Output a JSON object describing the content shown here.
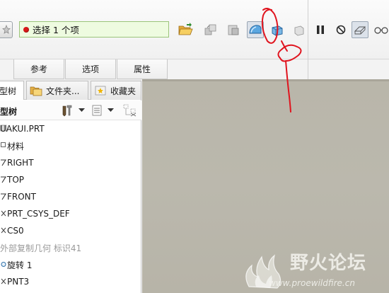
{
  "toolbar": {
    "selection_text": "选择 1 个项",
    "status_color": "#d81818"
  },
  "dashboard_tabs": [
    {
      "label": "参考"
    },
    {
      "label": "选项"
    },
    {
      "label": "属性"
    }
  ],
  "navigator_tabs": [
    {
      "label": "型树",
      "icon": "model-tree-icon"
    },
    {
      "label": "文件夹...",
      "icon": "folder-browser-icon"
    },
    {
      "label": "收藏夹",
      "icon": "favorites-icon"
    }
  ],
  "tree": {
    "header": "型树",
    "items": [
      {
        "lead": "",
        "label": "UAKUI.PRT",
        "icon": "part-icon",
        "disabled": false
      },
      {
        "lead": "□",
        "label": "材料",
        "icon": "material-icon",
        "disabled": false
      },
      {
        "lead": "7",
        "label": "RIGHT",
        "icon": "datum-plane-icon",
        "disabled": false
      },
      {
        "lead": "7",
        "label": "TOP",
        "icon": "datum-plane-icon",
        "disabled": false
      },
      {
        "lead": "7",
        "label": "FRONT",
        "icon": "datum-plane-icon",
        "disabled": false
      },
      {
        "lead": "×",
        "label": "PRT_CSYS_DEF",
        "icon": "csys-icon",
        "disabled": false
      },
      {
        "lead": "×",
        "label": "CS0",
        "icon": "csys-icon",
        "disabled": false
      },
      {
        "lead": "",
        "label": "外部复制几何 标识41",
        "icon": "external-copy-geometry-icon",
        "disabled": true
      },
      {
        "lead": "◇",
        "label": "旋转 1",
        "icon": "revolve-icon",
        "disabled": false
      },
      {
        "lead": "×",
        "label": "PNT3",
        "icon": "datum-point-icon",
        "disabled": false
      }
    ]
  },
  "watermark": {
    "title": "野火论坛",
    "url": "www.proewildfire.cn"
  },
  "colors": {
    "viewport_background": "#bab7ab",
    "selection_field": "#eefbe0",
    "annotation_ink": "#e0141e"
  }
}
